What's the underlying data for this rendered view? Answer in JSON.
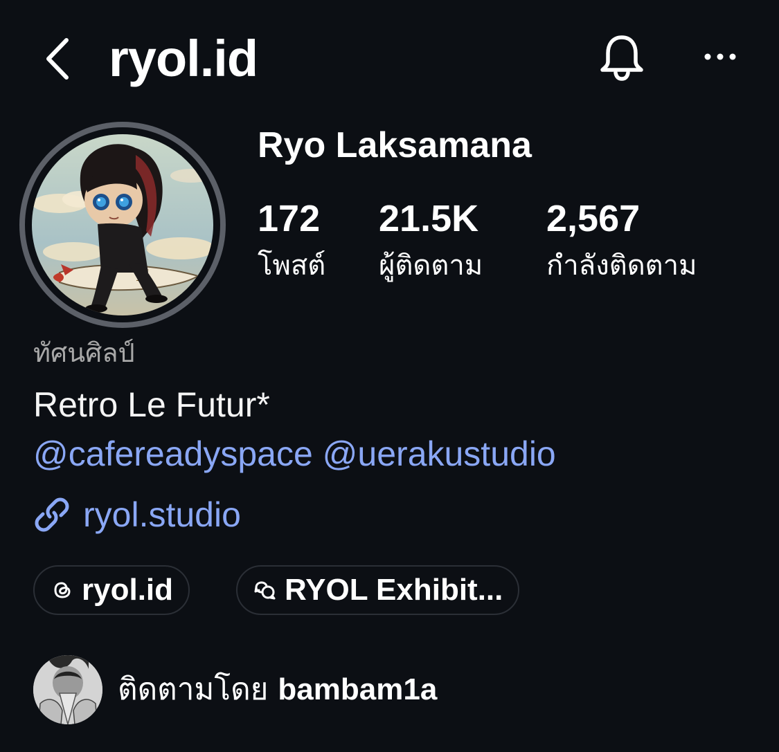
{
  "header": {
    "username": "ryol.id",
    "back_icon": "chevron-left-icon",
    "bell_icon": "bell-icon",
    "more_icon": "more-horizontal-icon"
  },
  "profile": {
    "display_name": "Ryo Laksamana",
    "avatar_icon": "profile-avatar"
  },
  "stats": [
    {
      "number": "172",
      "label": "โพสต์"
    },
    {
      "number": "21.5K",
      "label": "ผู้ติดตาม"
    },
    {
      "number": "2,567",
      "label": "กำลังติดตาม"
    }
  ],
  "bio": {
    "category": "ทัศนศิลป์",
    "text": "Retro Le Futur*",
    "mentions": [
      "@cafereadyspace",
      "@uerakustudio"
    ],
    "link": "ryol.studio",
    "link_icon": "link-icon"
  },
  "chips": [
    {
      "label": "ryol.id",
      "icon": "threads-icon"
    },
    {
      "label": "RYOL Exhibit...",
      "icon": "chat-bubbles-icon"
    }
  ],
  "followed_by": {
    "prefix": "ติดตามโดย",
    "username": "bambam1a"
  },
  "colors": {
    "background": "#0c0f14",
    "text": "#f5f5f5",
    "muted": "#a8a8a8",
    "link": "#8aa7f5",
    "chip_border": "#2b2f36",
    "avatar_ring": "#5c6068"
  }
}
